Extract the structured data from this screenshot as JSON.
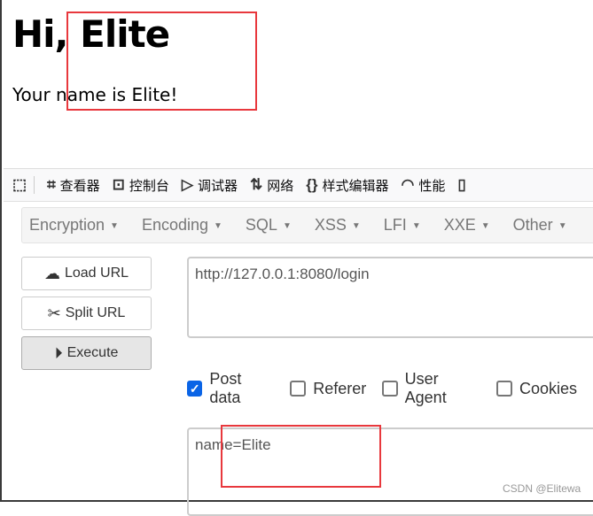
{
  "page": {
    "heading": "Hi, Elite",
    "message": "Your name is Elite!"
  },
  "devtools": {
    "tools": [
      {
        "icon": "pick-element-icon",
        "label": ""
      },
      {
        "icon": "inspector-icon",
        "label": "查看器"
      },
      {
        "icon": "console-icon",
        "label": "控制台"
      },
      {
        "icon": "debugger-icon",
        "label": "调试器"
      },
      {
        "icon": "network-icon",
        "label": "网络"
      },
      {
        "icon": "style-editor-icon",
        "label": "样式编辑器"
      },
      {
        "icon": "performance-icon",
        "label": "性能"
      },
      {
        "icon": "memory-icon",
        "label": ""
      }
    ]
  },
  "hackbar": {
    "menus": [
      "Encryption",
      "Encoding",
      "SQL",
      "XSS",
      "LFI",
      "XXE",
      "Other"
    ],
    "buttons": {
      "load": "Load URL",
      "split": "Split URL",
      "execute": "Execute"
    },
    "url": "http://127.0.0.1:8080/login",
    "options": [
      {
        "label": "Post data",
        "checked": true
      },
      {
        "label": "Referer",
        "checked": false
      },
      {
        "label": "User Agent",
        "checked": false
      },
      {
        "label": "Cookies",
        "checked": false
      }
    ],
    "post_body": "name=Elite"
  },
  "watermark": "CSDN @Elitewa",
  "colors": {
    "highlight": "#e8383d",
    "checkbox": "#0a64e6"
  }
}
